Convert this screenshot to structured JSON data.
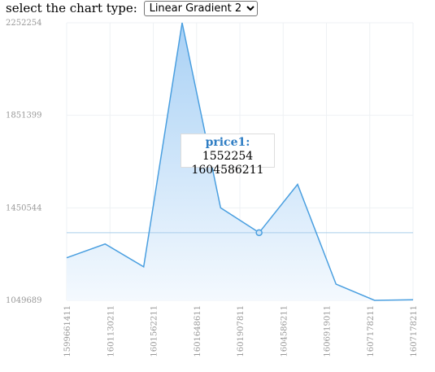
{
  "controls": {
    "label": "select the chart type:",
    "selected": "Linear Gradient 2"
  },
  "tooltip": {
    "series": "price1:",
    "value": "1552254",
    "x": "1604586211"
  },
  "colors": {
    "line": "#4a9fe0",
    "area_top": "#a9d1f5",
    "area_bottom": "#f4f9fe",
    "grid": "#eef1f4",
    "guide": "#a9cdea"
  },
  "chart_data": {
    "type": "area",
    "y_ticks": [
      "2252254",
      "1851399",
      "1450544",
      "1049689"
    ],
    "ylim": [
      1049689,
      2252254
    ],
    "x_tick_labels": [
      "1599661411",
      "1601130211",
      "1601562211",
      "1601648611",
      "1601907811",
      "1604586211",
      "1606919011",
      "1607178211",
      "1607178211"
    ],
    "series": [
      {
        "name": "price1",
        "values": [
          1234000,
          1294000,
          1195000,
          2252254,
          1450544,
          1343000,
          1552254,
          1120000,
          1049689,
          1052000
        ]
      }
    ],
    "highlight_index": 5,
    "xlabel": "",
    "ylabel": "",
    "title": ""
  }
}
